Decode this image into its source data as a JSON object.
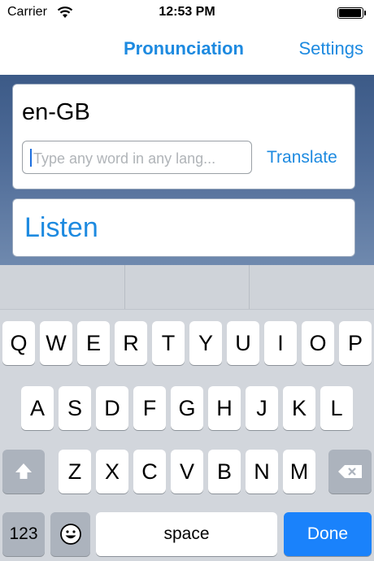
{
  "status_bar": {
    "carrier": "Carrier",
    "time": "12:53 PM"
  },
  "nav": {
    "title": "Pronunciation",
    "settings": "Settings"
  },
  "card": {
    "language": "en-GB",
    "input_value": "",
    "input_placeholder": "Type any word in any lang...",
    "translate": "Translate",
    "listen": "Listen"
  },
  "keyboard": {
    "row1": [
      "Q",
      "W",
      "E",
      "R",
      "T",
      "Y",
      "U",
      "I",
      "O",
      "P"
    ],
    "row2": [
      "A",
      "S",
      "D",
      "F",
      "G",
      "H",
      "J",
      "K",
      "L"
    ],
    "row3": [
      "Z",
      "X",
      "C",
      "V",
      "B",
      "N",
      "M"
    ],
    "numbers": "123",
    "space": "space",
    "done": "Done"
  },
  "colors": {
    "accent": "#1d8ae0",
    "done_key": "#1a82fb"
  }
}
